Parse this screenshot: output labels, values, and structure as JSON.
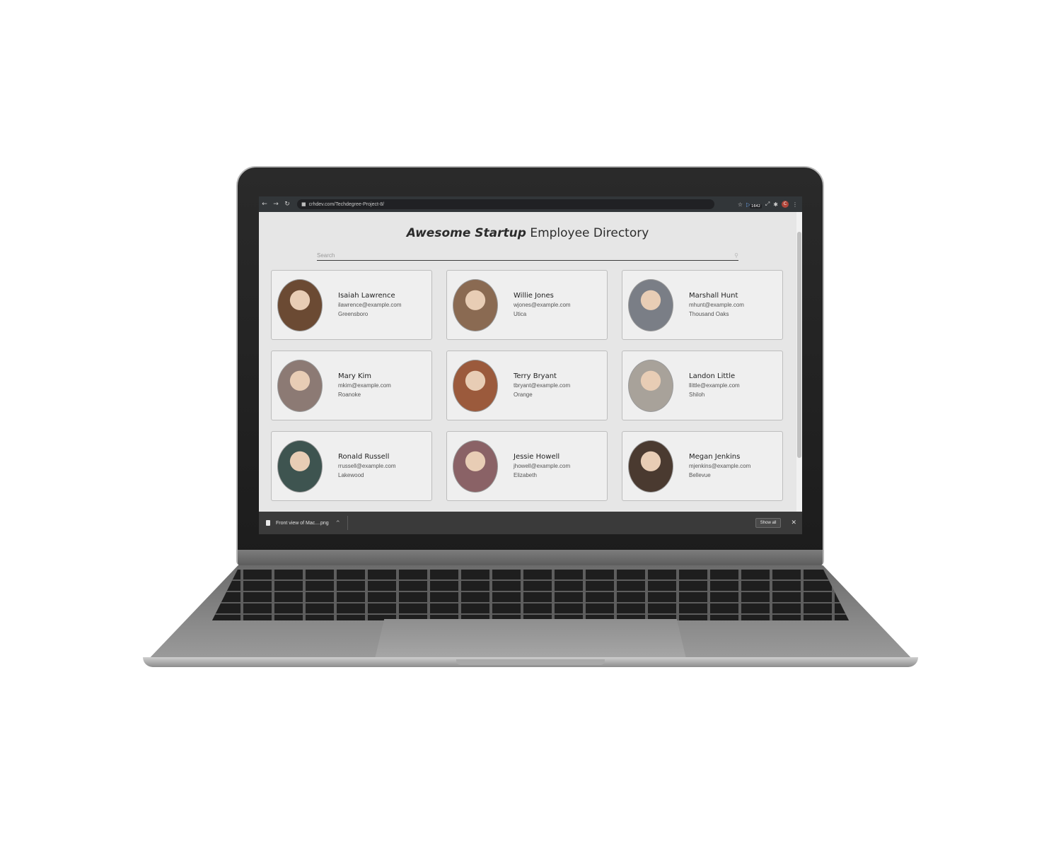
{
  "browser": {
    "url": "crhdev.com/Techdegree-Project-8/",
    "ext_badge": "1642",
    "profile_initial": "C"
  },
  "header": {
    "title_brand": "Awesome Startup",
    "title_rest": " Employee Directory"
  },
  "search": {
    "placeholder": "Search"
  },
  "employees": [
    {
      "name": "Isaiah Lawrence",
      "email": "ilawrence@example.com",
      "city": "Greensboro",
      "photo_color": "#6b4a33"
    },
    {
      "name": "Willie Jones",
      "email": "wjones@example.com",
      "city": "Utica",
      "photo_color": "#8a6a52"
    },
    {
      "name": "Marshall Hunt",
      "email": "mhunt@example.com",
      "city": "Thousand Oaks",
      "photo_color": "#7a7e86"
    },
    {
      "name": "Mary Kim",
      "email": "mkim@example.com",
      "city": "Roanoke",
      "photo_color": "#8c7a74"
    },
    {
      "name": "Terry Bryant",
      "email": "tbryant@example.com",
      "city": "Orange",
      "photo_color": "#9b5a3c"
    },
    {
      "name": "Landon Little",
      "email": "llittle@example.com",
      "city": "Shiloh",
      "photo_color": "#a8a29a"
    },
    {
      "name": "Ronald Russell",
      "email": "rrussell@example.com",
      "city": "Lakewood",
      "photo_color": "#3e5450"
    },
    {
      "name": "Jessie Howell",
      "email": "jhowell@example.com",
      "city": "Elizabeth",
      "photo_color": "#8a6266"
    },
    {
      "name": "Megan Jenkins",
      "email": "mjenkins@example.com",
      "city": "Bellevue",
      "photo_color": "#4a3a30"
    }
  ],
  "downloads": {
    "file_name": "Front view of Mac....png",
    "show_all_label": "Show all"
  },
  "icons": {
    "back": "back-arrow-icon",
    "forward": "forward-arrow-icon",
    "reload": "reload-icon",
    "lock": "lock-icon",
    "star": "star-icon",
    "extensions": "puzzle-icon",
    "menu": "kebab-menu-icon",
    "search": "search-icon",
    "close": "close-icon"
  }
}
